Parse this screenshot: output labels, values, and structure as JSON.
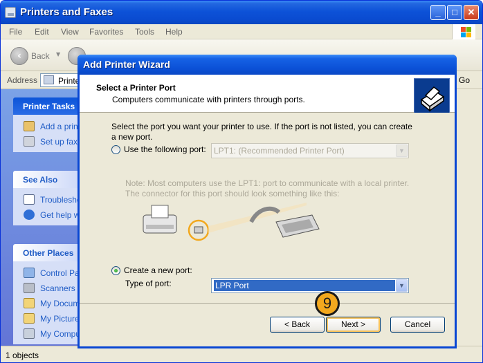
{
  "window": {
    "title": "Printers and Faxes",
    "title_icon": "printer-folder-icon"
  },
  "menu": [
    "File",
    "Edit",
    "View",
    "Favorites",
    "Tools",
    "Help"
  ],
  "toolbar": {
    "back_label": "Back"
  },
  "address": {
    "label": "Address",
    "value": "Printers and Faxes",
    "go_label": "Go"
  },
  "task_groups": [
    {
      "title": "Printer Tasks",
      "items": [
        "Add a printer",
        "Set up faxing"
      ]
    },
    {
      "title": "See Also",
      "items": [
        "Troubleshoot printing",
        "Get help with printing"
      ]
    },
    {
      "title": "Other Places",
      "items": [
        "Control Panel",
        "Scanners and Cameras",
        "My Documents",
        "My Pictures",
        "My Computer"
      ]
    }
  ],
  "status": {
    "text": "1 objects"
  },
  "wizard": {
    "title": "Add Printer Wizard",
    "header_title": "Select a Printer Port",
    "header_subtitle": "Computers communicate with printers through ports.",
    "description": "Select the port you want your printer to use.  If the port is not listed, you can create a new port.",
    "use_port_label": "Use the following port:",
    "use_port_value": "LPT1: (Recommended Printer Port)",
    "use_port_selected": false,
    "note": "Note: Most computers use the LPT1: port to communicate with a local printer. The connector for this port should look something like this:",
    "create_port_label": "Create a new port:",
    "create_port_selected": true,
    "type_label": "Type of port:",
    "type_value": "LPR Port",
    "back_label": "< Back",
    "next_label": "Next >",
    "cancel_label": "Cancel",
    "step_badge": "9"
  },
  "colors": {
    "title_blue": "#0a4bd0",
    "task_pane_blue": "#6375d6",
    "highlight_orange": "#f2a81e",
    "selection_blue": "#316ac5"
  }
}
